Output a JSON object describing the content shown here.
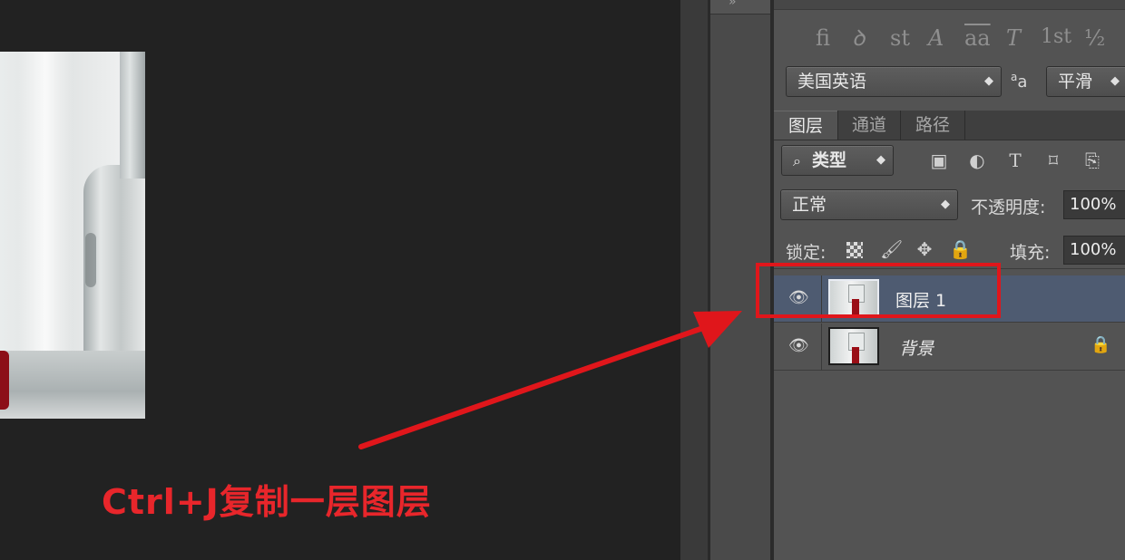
{
  "character_panel": {
    "glyphs": [
      "fi",
      "ꝺ",
      "st",
      "A",
      "aa",
      "T",
      "1st",
      "½"
    ],
    "language": "美国英语",
    "antialias_icon": "aa",
    "antialias": "平滑"
  },
  "layers_panel": {
    "tabs": [
      "图层",
      "通道",
      "路径"
    ],
    "active_tab": "图层",
    "filter": "类型",
    "filter_icons": [
      "image-filter-icon",
      "adjustment-filter-icon",
      "type-filter-icon",
      "shape-filter-icon",
      "smart-object-filter-icon"
    ],
    "blend_mode": "正常",
    "opacity_label": "不透明度:",
    "opacity": "100%",
    "lock_label": "锁定:",
    "fill_label": "填充:",
    "fill": "100%",
    "layers": [
      {
        "name": "图层 1",
        "selected": true,
        "visible": true,
        "locked": false
      },
      {
        "name": "背景",
        "selected": false,
        "visible": true,
        "locked": true
      }
    ]
  },
  "annotation": {
    "caption": "Ctrl+J复制一层图层",
    "color": "#e0161b"
  },
  "colors": {
    "canvas_bg": "#222222",
    "panel_bg": "#535353",
    "selected_layer_bg": "#4e5b71"
  }
}
